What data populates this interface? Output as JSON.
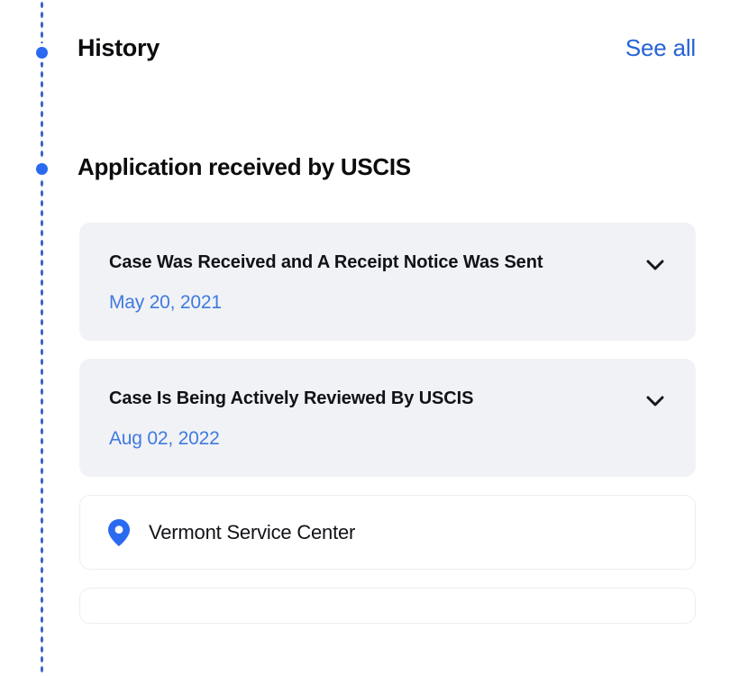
{
  "theme": {
    "accent_blue": "#2a6af0",
    "link_blue": "#2563d6",
    "date_blue": "#3f7ae0",
    "card_bg": "#f1f2f6",
    "page_bg": "#ffffff",
    "text_black": "#111216"
  },
  "header": {
    "title": "History",
    "see_all_label": "See all"
  },
  "section": {
    "heading": "Application received by USCIS"
  },
  "cards": [
    {
      "type": "status",
      "title": "Case Was Received and A Receipt Notice Was Sent",
      "date": "May 20, 2021",
      "chevron_icon": "chevron-down-icon"
    },
    {
      "type": "status",
      "title": "Case Is Being Actively Reviewed By USCIS",
      "date": "Aug 02, 2022",
      "chevron_icon": "chevron-down-icon"
    },
    {
      "type": "location",
      "icon": "map-pin-icon",
      "label": "Vermont Service Center"
    }
  ]
}
